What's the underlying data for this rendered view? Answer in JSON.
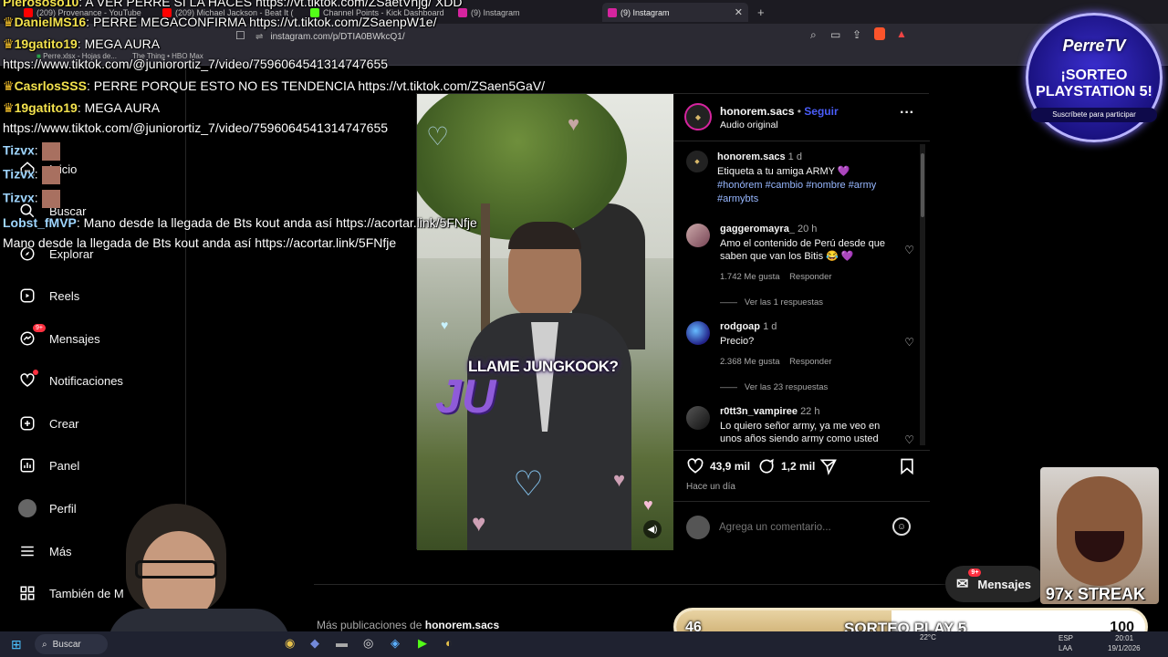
{
  "browser": {
    "tabs": [
      {
        "label": "(209) Provenance - YouTube",
        "fav": "#ff0000"
      },
      {
        "label": "(209) Michael Jackson - Beat It (",
        "fav": "#ff0000"
      },
      {
        "label": "Channel Points - Kick Dashboard",
        "fav": "#53fc18"
      },
      {
        "label": "(9) Instagram",
        "fav": "#d6249f"
      },
      {
        "label": "(9) Instagram",
        "fav": "#d6249f"
      }
    ],
    "new_tab": "+",
    "url": "instagram.com/p/DTIA0BWkcQ1/",
    "bookmarks": [
      "Perre.xlsx - Hojas de...",
      "The Thing • HBO Max"
    ]
  },
  "sidebar": {
    "items": [
      {
        "label": "Inicio",
        "icon": "home-icon"
      },
      {
        "label": "Buscar",
        "icon": "search-icon"
      },
      {
        "label": "Explorar",
        "icon": "compass-icon"
      },
      {
        "label": "Reels",
        "icon": "reels-icon"
      },
      {
        "label": "Mensajes",
        "icon": "messenger-icon",
        "badge": "9+"
      },
      {
        "label": "Notificaciones",
        "icon": "heart-icon"
      },
      {
        "label": "Crear",
        "icon": "plus-square-icon"
      },
      {
        "label": "Panel",
        "icon": "chart-icon"
      },
      {
        "label": "Perfil",
        "icon": "avatar-icon"
      },
      {
        "label": "Más",
        "icon": "menu-icon"
      },
      {
        "label": "También de M",
        "icon": "grid-icon"
      }
    ]
  },
  "post": {
    "username": "honorem.sacs",
    "follow": "Seguir",
    "separator": "•",
    "audio": "Audio original",
    "more": "···",
    "video_caption": "LLAME JUNGKOOK?",
    "video_logo": "JU",
    "caption": {
      "username": "honorem.sacs",
      "time": "1 d",
      "text": "Etiqueta a tu amiga ARMY 💜",
      "tags": "#honórem #cambio #nombre #army #armybts"
    },
    "comments": [
      {
        "user": "gaggeromayra_",
        "time": "20 h",
        "text": "Amo el contenido de Perú desde que saben que van los Bitis 😂 💜",
        "likes": "1.742 Me gusta",
        "reply": "Responder",
        "view_replies": "Ver las 1 respuestas"
      },
      {
        "user": "rodgoap",
        "time": "1 d",
        "text": "Precio?",
        "likes": "2.368 Me gusta",
        "reply": "Responder",
        "view_replies": "Ver las 23 respuestas"
      },
      {
        "user": "r0tt3n_vampiree",
        "time": "22 h",
        "text": "Lo quiero señor army, ya me veo en unos años siendo army como usted",
        "likes": "",
        "reply": "",
        "view_replies": ""
      }
    ],
    "likes_count": "43,9 mil",
    "comments_count": "1,2 mil",
    "posted": "Hace un día",
    "comment_placeholder": "Agrega un comentario..."
  },
  "more_posts": {
    "prefix": "Más publicaciones de",
    "user": "honorem.sacs"
  },
  "messages_button": {
    "label": "Mensajes",
    "badge": "9+"
  },
  "chat": [
    {
      "user": "Pierososo10",
      "msg": "A VER PERRE SI LA HACES https://vt.tiktok.com/ZSaetVhjg/ XDD"
    },
    {
      "user": "DanielMS16",
      "msg": "PERRE MEGACONFIRMA https://vt.tiktok.com/ZSaenpW1e/"
    },
    {
      "user": "19gatito19",
      "msg": "MEGA AURA"
    },
    {
      "user": "",
      "msg": "https://www.tiktok.com/@juniorortiz_7/video/7596064541314747655"
    },
    {
      "user": "CasrlosSSS",
      "msg": "PERRE PORQUE ESTO NO ES TENDENCIA https://vt.tiktok.com/ZSaen5GaV/"
    },
    {
      "user": "19gatito19",
      "msg": "MEGA AURA"
    },
    {
      "user": "",
      "msg": "https://www.tiktok.com/@juniorortiz_7/video/7596064541314747655"
    },
    {
      "user": "Tizvx",
      "msg": ""
    },
    {
      "user": "Tizvx",
      "msg": ""
    },
    {
      "user": "Tizvx",
      "msg": ""
    },
    {
      "user": "Lobst_fMVP",
      "msg": "Mano desde la llegada de Bts kout anda así https://acortar.link/5FNfje"
    },
    {
      "user": "",
      "msg": "Mano desde la llegada de Bts kout anda así https://acortar.link/5FNfje"
    }
  ],
  "stream": {
    "brand": "PerreTV",
    "promo_title": "¡SORTEO PLAYSTATION 5!",
    "promo_sub": "Suscríbete para participar",
    "streak": "97x STREAK",
    "goal_current": "46",
    "goal_label": "SORTEO PLAY 5",
    "goal_target": "100",
    "goal_progress": 0.46
  },
  "taskbar": {
    "search": "Buscar",
    "weather": "22°C",
    "lang": "ESP",
    "lang2": "LAA",
    "time": "20:01",
    "date": "19/1/2026"
  },
  "colors": {
    "accent": "#4a5df9",
    "badge": "#ff3040",
    "goal_fill": "#c9a868"
  }
}
